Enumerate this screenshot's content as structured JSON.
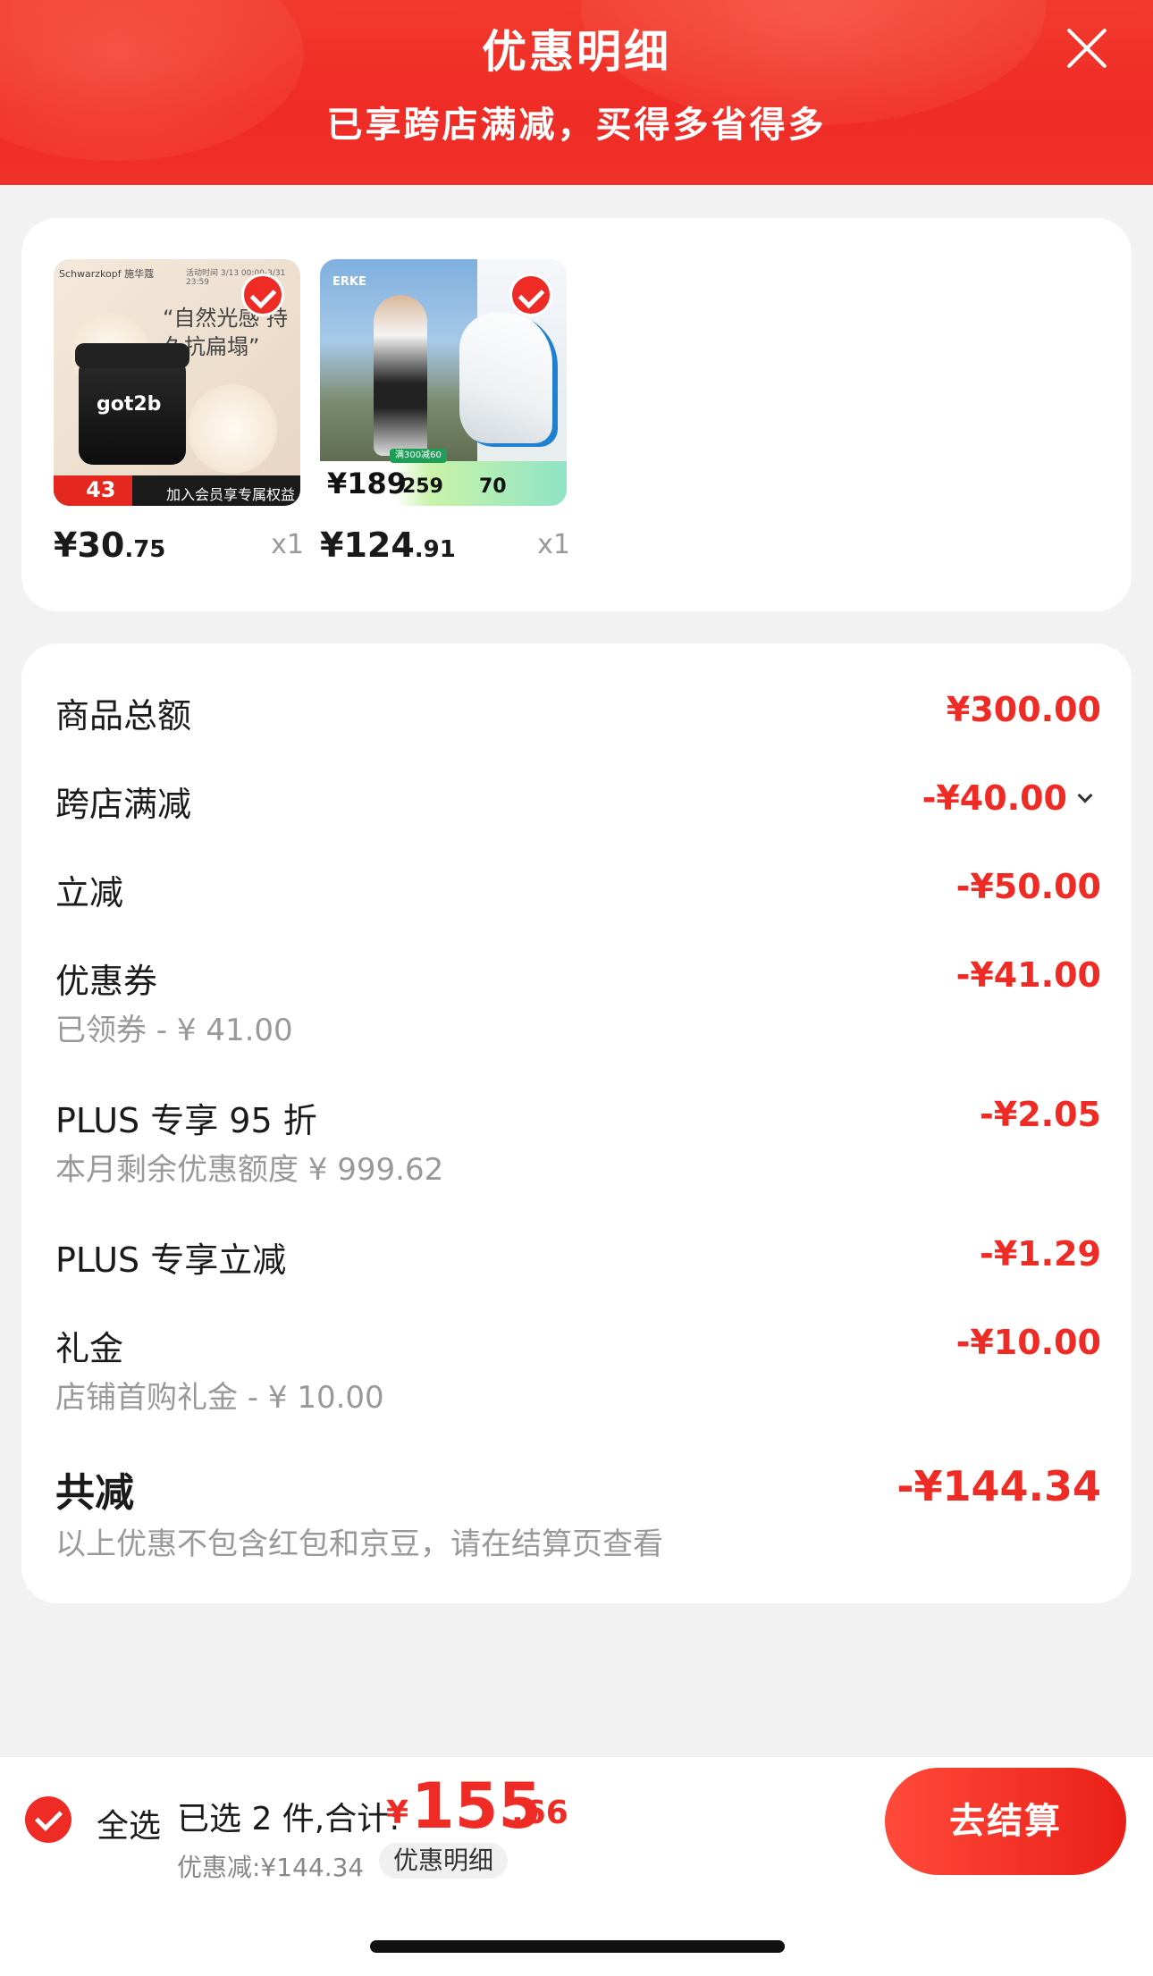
{
  "header": {
    "title": "优惠明细",
    "subtitle": "已享跨店满减，买得多省得多"
  },
  "products": [
    {
      "price_int": "¥30",
      "price_dec": ".75",
      "qty": "x1",
      "image": {
        "brand": "Schwarzkopf 施华蔻",
        "time": "活动时间 3/13 00:00-3/31 23:59",
        "quote": "“自然光感 持久抗扁塌”",
        "jar_label": "got2b",
        "badge_price": "43",
        "bar_text": "加入会员享专属权益"
      }
    },
    {
      "price_int": "¥124",
      "price_dec": ".91",
      "qty": "x1",
      "image": {
        "logo": "ERKE",
        "tag": "满300减60",
        "price_a": "¥189",
        "price_b": "259",
        "price_c": "70"
      }
    }
  ],
  "details": {
    "subtotal": {
      "label": "商品总额",
      "amount": "¥300.00"
    },
    "cross_store": {
      "label": "跨店满减",
      "amount": "-¥40.00"
    },
    "instant": {
      "label": "立减",
      "amount": "-¥50.00"
    },
    "coupon": {
      "label": "优惠券",
      "sub": "已领券 - ¥ 41.00",
      "amount": "-¥41.00"
    },
    "plus_discount": {
      "label": "PLUS 专享 95 折",
      "sub": "本月剩余优惠额度 ¥ 999.62",
      "amount": "-¥2.05"
    },
    "plus_instant": {
      "label": "PLUS 专享立减",
      "amount": "-¥1.29"
    },
    "gift": {
      "label": "礼金",
      "sub": "店铺首购礼金 - ¥ 10.00",
      "amount": "-¥10.00"
    },
    "total": {
      "label": "共减",
      "sub": "以上优惠不包含红包和京豆，请在结算页查看",
      "amount": "-¥144.34"
    }
  },
  "bottom": {
    "select_all": "全选",
    "selected": "已选 2 件,合计:",
    "total_symbol": "¥",
    "total_int": "155",
    "total_dec": ".66",
    "discount": "优惠减:¥144.34",
    "details_link": "优惠明细",
    "checkout": "去结算"
  },
  "colors": {
    "accent": "#ef2b25",
    "background": "#f2f2f2"
  }
}
